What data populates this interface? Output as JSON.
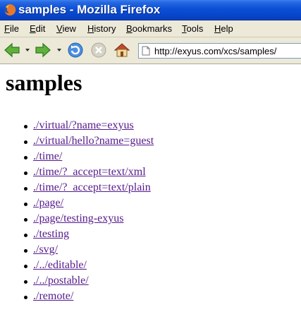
{
  "window": {
    "title": "samples - Mozilla Firefox",
    "icons": {
      "app": "firefox-icon"
    }
  },
  "menubar": {
    "items": [
      {
        "label": "File",
        "accel": "F",
        "rest": "ile"
      },
      {
        "label": "Edit",
        "accel": "E",
        "rest": "dit"
      },
      {
        "label": "View",
        "accel": "V",
        "rest": "iew"
      },
      {
        "label": "History",
        "accel": "H",
        "rest": "istory"
      },
      {
        "label": "Bookmarks",
        "accel": "B",
        "rest": "ookmarks"
      },
      {
        "label": "Tools",
        "accel": "T",
        "rest": "ools"
      },
      {
        "label": "Help",
        "accel": "H",
        "rest": "elp"
      }
    ]
  },
  "toolbar": {
    "icons": {
      "back": "back-arrow-icon",
      "forward": "forward-arrow-icon",
      "reload": "reload-icon",
      "stop": "stop-icon",
      "home": "home-icon",
      "page": "page-icon"
    },
    "url": "http://exyus.com/xcs/samples/"
  },
  "page": {
    "heading": "samples",
    "links": [
      "./virtual/?name=exyus",
      "./virtual/hello?name=guest",
      "./time/",
      "./time/?_accept=text/xml",
      "./time/?_accept=text/plain",
      "./page/",
      "./page/testing-exyus",
      "./testing",
      "./svg/",
      "./../editable/",
      "./../postable/",
      "./remote/"
    ]
  },
  "colors": {
    "titlebar": "#0a4fd6",
    "chrome": "#ece9d8",
    "visited_link": "#551a8b"
  }
}
